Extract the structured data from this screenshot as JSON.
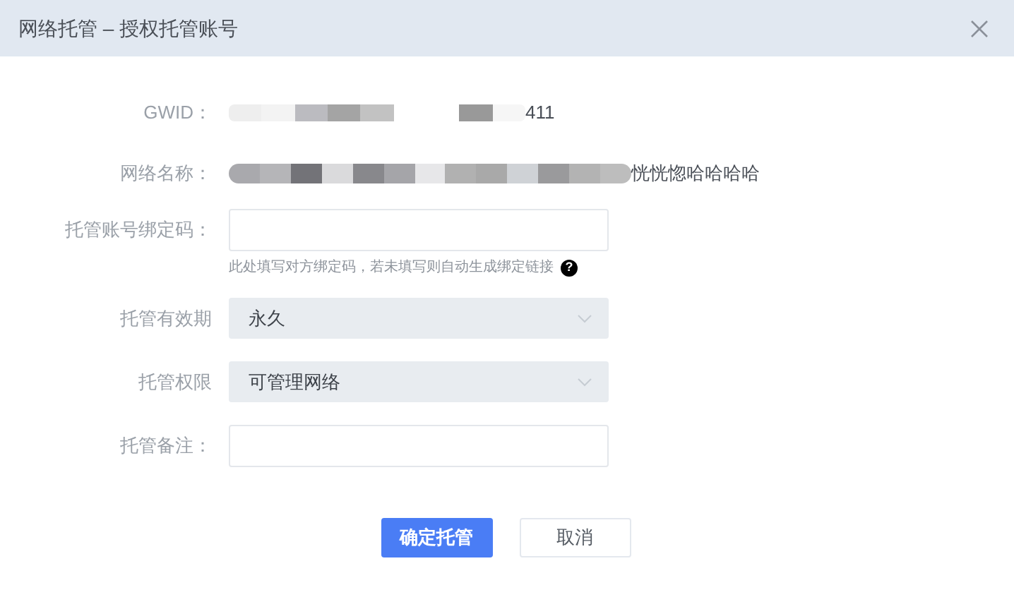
{
  "window": {
    "title": "网络托管 – 授权托管账号"
  },
  "fields": [
    {
      "kind": "text",
      "label": "GWID：",
      "value": "411"
    },
    {
      "kind": "text",
      "label": "网络名称：",
      "value": "恍恍惚哈哈哈哈"
    },
    {
      "kind": "input",
      "label": "托管账号绑定码：",
      "hint": "此处填写对方绑定码，若未填写则自动生成绑定链接",
      "help": "?"
    },
    {
      "kind": "select",
      "label": "托管有效期",
      "value": "永久"
    },
    {
      "kind": "select",
      "label": "托管权限",
      "value": "可管理网络"
    },
    {
      "kind": "input",
      "label": "托管备注："
    }
  ],
  "buttons": [
    {
      "label": "确定托管",
      "primary": true
    },
    {
      "label": "取消",
      "primary": false
    }
  ]
}
